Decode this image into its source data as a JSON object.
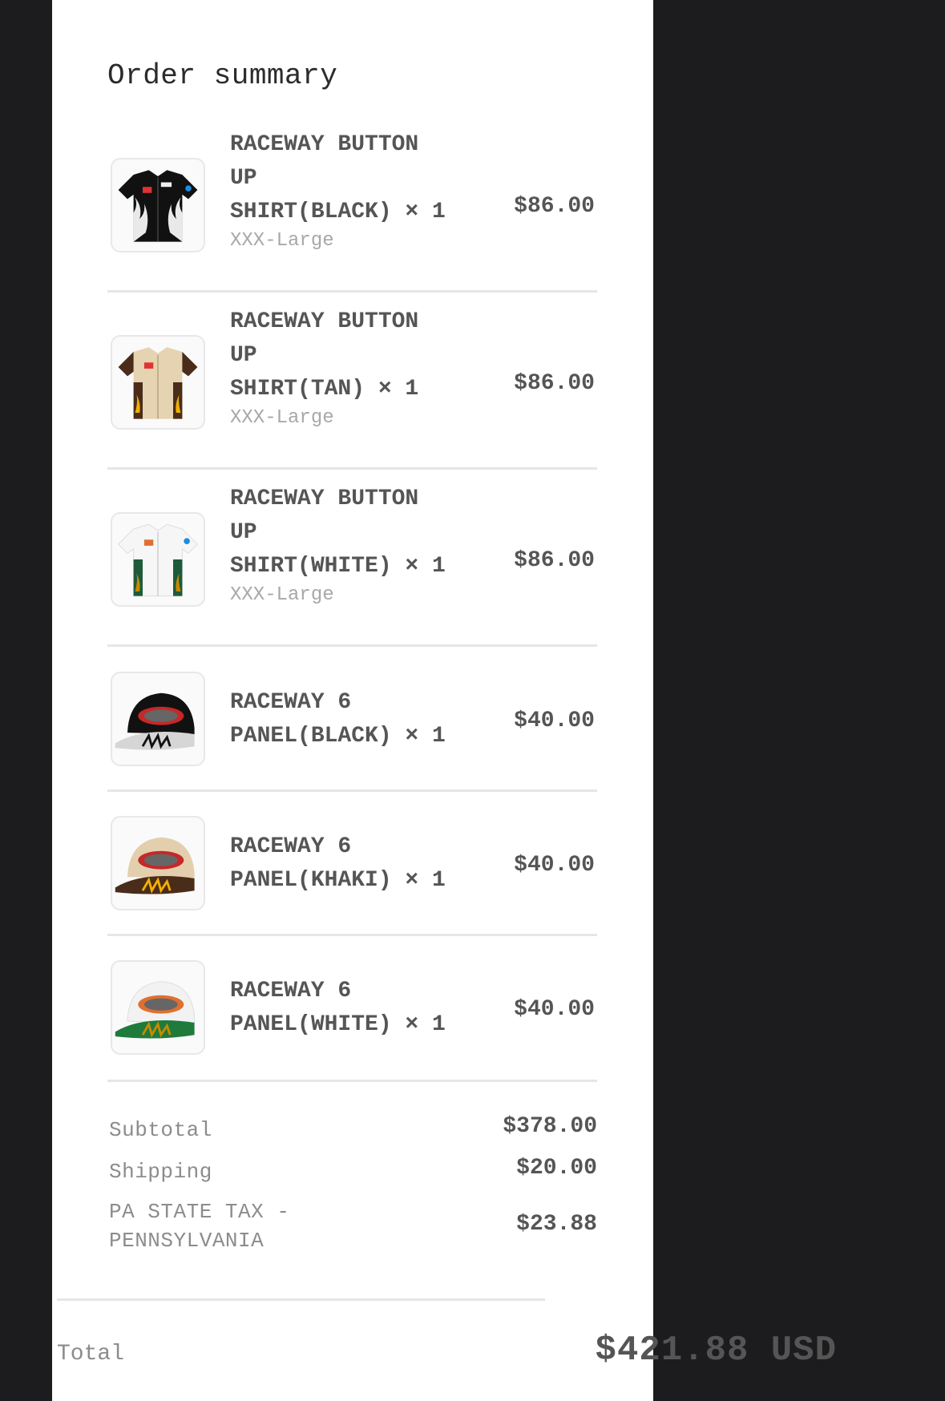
{
  "title": "Order summary",
  "items": [
    {
      "name": "RACEWAY BUTTON UP SHIRT(BLACK)",
      "line1": "RACEWAY BUTTON",
      "line2": "UP",
      "line3": "SHIRT(BLACK) × 1",
      "variant": "XXX-Large",
      "price": "$86.00",
      "thumb_icon": "black-racing-shirt-image",
      "colors": {
        "base": "#111111",
        "accent": "#ffffff"
      }
    },
    {
      "name": "RACEWAY BUTTON UP SHIRT(TAN)",
      "line1": "RACEWAY BUTTON",
      "line2": "UP",
      "line3": "SHIRT(TAN) × 1",
      "variant": "XXX-Large",
      "price": "$86.00",
      "thumb_icon": "tan-racing-shirt-image",
      "colors": {
        "base": "#e6d3b1",
        "accent": "#4a2c1a"
      }
    },
    {
      "name": "RACEWAY BUTTON UP SHIRT(WHITE)",
      "line1": "RACEWAY BUTTON",
      "line2": "UP",
      "line3": "SHIRT(WHITE) × 1",
      "variant": "XXX-Large",
      "price": "$86.00",
      "thumb_icon": "white-racing-shirt-image",
      "colors": {
        "base": "#f4f4f4",
        "accent": "#1f5a3a"
      }
    },
    {
      "name": "RACEWAY 6 PANEL(BLACK)",
      "line1": "RACEWAY 6",
      "line2": "PANEL(BLACK) × 1",
      "price": "$40.00",
      "thumb_icon": "black-cap-image",
      "colors": {
        "base": "#111111",
        "accent": "#d9d9d9"
      }
    },
    {
      "name": "RACEWAY 6 PANEL(KHAKI)",
      "line1": "RACEWAY 6",
      "line2": "PANEL(KHAKI) × 1",
      "price": "$40.00",
      "thumb_icon": "khaki-cap-image",
      "colors": {
        "base": "#e3cfae",
        "accent": "#4a2c1a"
      }
    },
    {
      "name": "RACEWAY 6 PANEL(WHITE)",
      "line1": "RACEWAY 6",
      "line2": "PANEL(WHITE) × 1",
      "price": "$40.00",
      "thumb_icon": "white-cap-image",
      "colors": {
        "base": "#f2f2f2",
        "accent": "#1f7a3c"
      }
    }
  ],
  "summary": {
    "subtotal_label": "Subtotal",
    "subtotal_value": "$378.00",
    "shipping_label": "Shipping",
    "shipping_value": "$20.00",
    "tax_label_line1": "PA STATE TAX -",
    "tax_label_line2": "PENNSYLVANIA",
    "tax_value": "$23.88",
    "total_label": "Total",
    "total_value": "$421.88 USD"
  }
}
